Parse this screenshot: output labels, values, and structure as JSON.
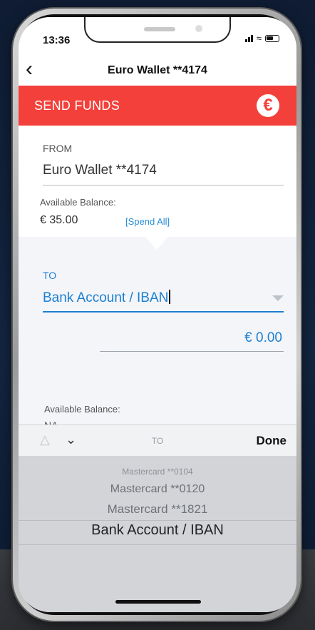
{
  "status_bar": {
    "time": "13:36"
  },
  "nav": {
    "title": "Euro Wallet **4174",
    "back_icon": "chevron-left-icon"
  },
  "header": {
    "title": "SEND FUNDS",
    "badge": "€",
    "accent_color": "#f4403a"
  },
  "from": {
    "label": "FROM",
    "wallet": "Euro Wallet **4174",
    "available_label": "Available Balance:",
    "available_value": "€ 35.00",
    "spend_all": "[Spend All]"
  },
  "to": {
    "label": "TO",
    "selected": "Bank Account / IBAN",
    "amount": "€ 0.00",
    "available_label": "Available Balance:",
    "available_value": "NA"
  },
  "picker": {
    "toolbar_title": "TO",
    "done_label": "Done",
    "options": [
      "Mastercard **0104",
      "Mastercard **0120",
      "Mastercard **1821",
      "Bank Account / IBAN"
    ],
    "selected_index": 3
  }
}
